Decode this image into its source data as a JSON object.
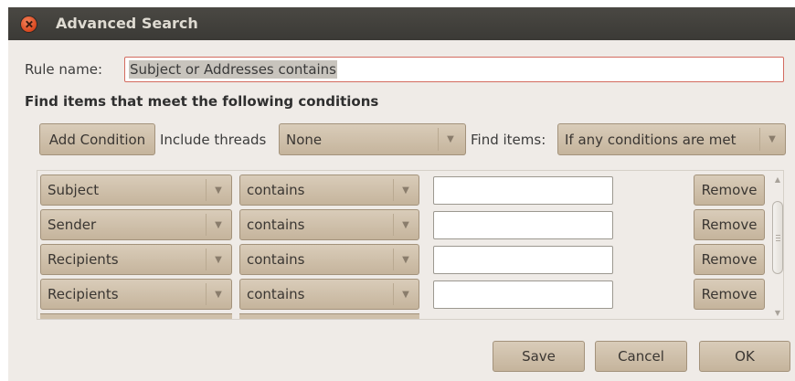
{
  "window": {
    "title": "Advanced Search"
  },
  "rule_name": {
    "label": "Rule name:",
    "value": "Subject or Addresses contains"
  },
  "heading": "Find items that meet the following conditions",
  "toolbar": {
    "add_condition_label": "Add Condition",
    "include_threads_label": "Include threads",
    "include_threads_value": "None",
    "find_items_label": "Find items:",
    "find_items_value": "If any conditions are met"
  },
  "conditions": [
    {
      "field": "Subject",
      "operator": "contains",
      "value": "",
      "remove_label": "Remove"
    },
    {
      "field": "Sender",
      "operator": "contains",
      "value": "",
      "remove_label": "Remove"
    },
    {
      "field": "Recipients",
      "operator": "contains",
      "value": "",
      "remove_label": "Remove"
    },
    {
      "field": "Recipients",
      "operator": "contains",
      "value": "",
      "remove_label": "Remove"
    }
  ],
  "buttons": {
    "save": "Save",
    "cancel": "Cancel",
    "ok": "OK"
  },
  "colors": {
    "titlebar": "#3f3e3a",
    "dialog_bg": "#efebe7",
    "button": "#cfc0aa",
    "focus_border": "#d36b5f"
  },
  "icons": {
    "close": "close-icon",
    "dropdown": "chevron-down-icon"
  }
}
